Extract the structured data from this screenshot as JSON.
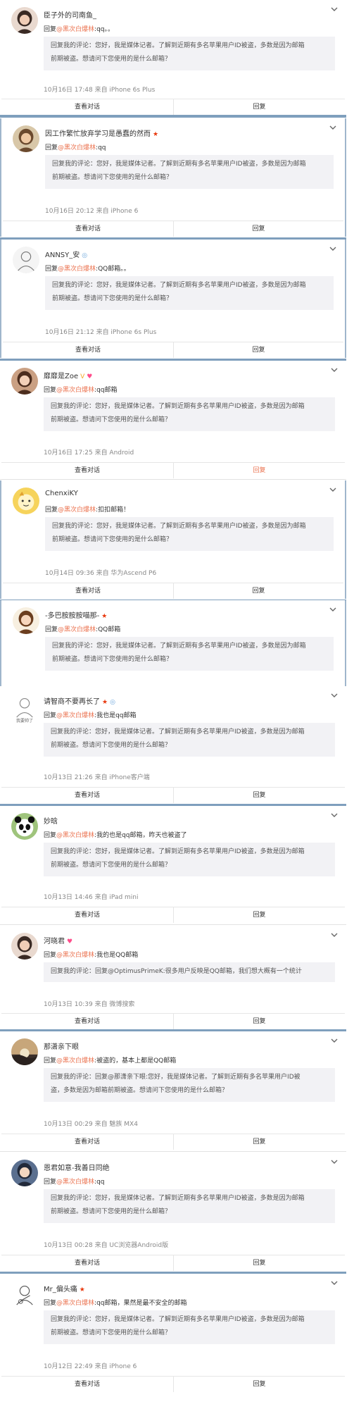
{
  "cards": [
    {
      "name": "臣子外的司南鱼_",
      "badges": [],
      "reply_prefix": "回复",
      "mention": "@黑次白爆林",
      "reply_text": ":qq。。",
      "quote_lines": [
        "回复我的评论：您好，我是媒体记者。了解到近期有多名苹果用户ID被盗，多数是因为邮箱",
        "前期被盗。想请问下您使用的是什么邮箱？"
      ],
      "meta": "10月16日 17:48 来自 iPhone 6s Plus",
      "view_label": "查看对话",
      "reply_label": "回复",
      "avatar": "girl-dark"
    },
    {
      "name": "因工作繁忙放弃学习是愚蠢的然而",
      "badges": [
        "★"
      ],
      "reply_prefix": "回复",
      "mention": "@黑次白爆林",
      "reply_text": ":qq",
      "quote_lines": [
        "回复我的评论：您好，我是媒体记者。了解到近期有多名苹果用户ID被盗，多数是因为邮箱",
        "前期被盗。想请问下您使用的是什么邮箱？"
      ],
      "meta": "10月16日 20:12 来自 iPhone 6",
      "view_label": "查看对话",
      "reply_label": "回复",
      "avatar": "boy-brown"
    },
    {
      "name": "ANNSY_安",
      "badges": [
        "◎"
      ],
      "reply_prefix": "回复",
      "mention": "@黑次白爆林",
      "reply_text": ":QQ邮箱。。",
      "quote_lines": [
        "回复我的评论：您好，我是媒体记者。了解到近期有多名苹果用户ID被盗，多数是因为邮箱",
        "前期被盗。想请问下您使用的是什么邮箱？"
      ],
      "meta": "10月16日 21:12 来自 iPhone 6s Plus",
      "view_label": "查看对话",
      "reply_label": "回复",
      "avatar": "sketch"
    },
    {
      "name": "靡靡是Zoe",
      "badges": [
        "V",
        "♥"
      ],
      "reply_prefix": "回复",
      "mention": "@黑次白爆林",
      "reply_text": ":qq邮箱",
      "quote_lines": [
        "回复我的评论：您好，我是媒体记者。了解到近期有多名苹果用户ID被盗，多数是因为邮箱",
        "前期被盗。想请问下您使用的是什么邮箱？"
      ],
      "meta": "10月16日 17:25 来自 Android",
      "view_label": "查看对话",
      "reply_label": "回复",
      "avatar": "girl-warm"
    },
    {
      "name": "ChenxiKY",
      "badges": [],
      "reply_prefix": "回复",
      "mention": "@黑次白爆林",
      "reply_text": ":扣扣邮箱！",
      "quote_lines": [
        "回复我的评论：您好，我是媒体记者。了解到近期有多名苹果用户ID被盗，多数是因为邮箱",
        "前期被盗。想请问下您使用的是什么邮箱？"
      ],
      "meta": "10月14日 09:36 来自 华为Ascend P6",
      "view_label": "查看对话",
      "reply_label": "回复",
      "avatar": "cartoon-yellow"
    },
    {
      "name": "-多巴胺胺胺喵那-",
      "badges": [
        "★"
      ],
      "reply_prefix": "回复",
      "mention": "@黑次白爆林",
      "reply_text": ":QQ邮箱",
      "quote_lines": [
        "回复我的评论：您好，我是媒体记者。了解到近期有多名苹果用户ID被盗，多数是因为邮箱",
        "前期被盗。想请问下您使用的是什么邮箱？"
      ],
      "meta": "",
      "view_label": "",
      "reply_label": "",
      "avatar": "girl-cartoon"
    },
    {
      "name": "请智商不要再长了",
      "badges": [
        "★",
        "◎"
      ],
      "reply_prefix": "回复",
      "mention": "@黑次白爆林",
      "reply_text": ":我也是qq邮箱",
      "quote_lines": [
        "回复我的评论：您好，我是媒体记者。了解到近期有多名苹果用户ID被盗，多数是因为邮箱",
        "前期被盗。想请问下您使用的是什么邮箱？"
      ],
      "meta": "10月13日 21:26 来自 iPhone客户端",
      "view_label": "查看对话",
      "reply_label": "回复",
      "avatar": "sketch-text",
      "avatar_caption": "我要帅了"
    },
    {
      "name": "妙晗",
      "badges": [],
      "reply_prefix": "回复",
      "mention": "@黑次白爆林",
      "reply_text": ":我的也是qq邮箱，昨天也被盗了",
      "quote_lines": [
        "回复我的评论：您好，我是媒体记者。了解到近期有多名苹果用户ID被盗，多数是因为邮箱",
        "前期被盗。想请问下您使用的是什么邮箱？"
      ],
      "meta": "10月13日 14:46 来自 iPad mini",
      "view_label": "查看对话",
      "reply_label": "回复",
      "avatar": "panda"
    },
    {
      "name": "河晓君",
      "badges": [
        "♥"
      ],
      "reply_prefix": "回复",
      "mention": "@黑次白爆林",
      "reply_text": ":我也是QQ邮箱",
      "quote_lines": [
        "回复我的评论：回复@OptimusPrimeK:很多用户反映是QQ邮箱，我们想大概有一个统计"
      ],
      "meta": "10月13日 10:39 来自 微博搜索",
      "view_label": "查看对话",
      "reply_label": "回复",
      "avatar": "girl-dark"
    },
    {
      "name": "那潇亲下眼",
      "badges": [],
      "reply_prefix": "回复",
      "mention": "@黑次白爆林",
      "reply_text": ":被盗的，基本上都是QQ邮箱",
      "quote_lines": [
        "回复我的评论：回复@那潇亲下眼:您好，我是媒体记者。了解到近期有多名苹果用户ID被",
        "盗，多数是因为邮箱前期被盗。想请问下您使用的是什么邮箱？"
      ],
      "meta": "10月13日 00:29 来自 魅族 MX4",
      "view_label": "查看对话",
      "reply_label": "回复",
      "avatar": "sunset"
    },
    {
      "name": "恩君如意-我善日同绝",
      "badges": [],
      "reply_prefix": "回复",
      "mention": "@黑次白爆林",
      "reply_text": ":qq",
      "quote_lines": [
        "回复我的评论：您好，我是媒体记者。了解到近期有多名苹果用户ID被盗，多数是因为邮箱",
        "前期被盗。想请问下您使用的是什么邮箱？"
      ],
      "meta": "10月13日 00:28 来自 UC浏览器Android版",
      "view_label": "查看对话",
      "reply_label": "回复",
      "avatar": "boy-anime"
    },
    {
      "name": "Mr_偏头痛",
      "badges": [
        "★"
      ],
      "reply_prefix": "回复",
      "mention": "@黑次白爆林",
      "reply_text": ":qq邮箱，果然是最不安全的邮箱",
      "quote_lines": [
        "回复我的评论：您好，我是媒体记者。了解到近期有多名苹果用户ID被盗，多数是因为邮箱",
        "前期被盗。想请问下您使用的是什么邮箱？"
      ],
      "meta": "10月12日 22:49 来自 iPhone 6",
      "view_label": "查看对话",
      "reply_label": "回复",
      "avatar": "sketch-guitar"
    }
  ],
  "colors": {
    "mention": "#eb7350",
    "star": "#e8380d",
    "frame": "#9fb6cc",
    "separator": "#7f9fbd",
    "quote_bg": "#f2f2f5"
  },
  "icons": {
    "collapse": "chevron-down-icon"
  }
}
